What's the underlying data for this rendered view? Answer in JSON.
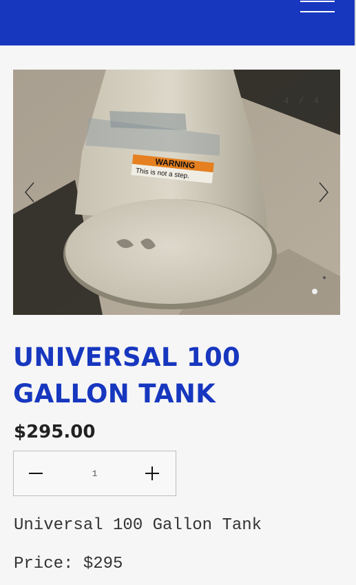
{
  "header": {
    "menu_icon": "hamburger-menu-icon",
    "brand_color": "#1737bf"
  },
  "gallery": {
    "counter": "4 / 4",
    "prev_icon": "chevron-left-icon",
    "next_icon": "chevron-right-icon",
    "photo_label_line1": "WARNING",
    "photo_label_line2": "This is not a step."
  },
  "product": {
    "title": "UNIVERSAL 100 GALLON TANK",
    "price": "$295.00",
    "quantity": "1",
    "decrease_icon": "minus-icon",
    "increase_icon": "plus-icon",
    "description": [
      "Universal 100 Gallon Tank",
      "Price: $295"
    ]
  }
}
